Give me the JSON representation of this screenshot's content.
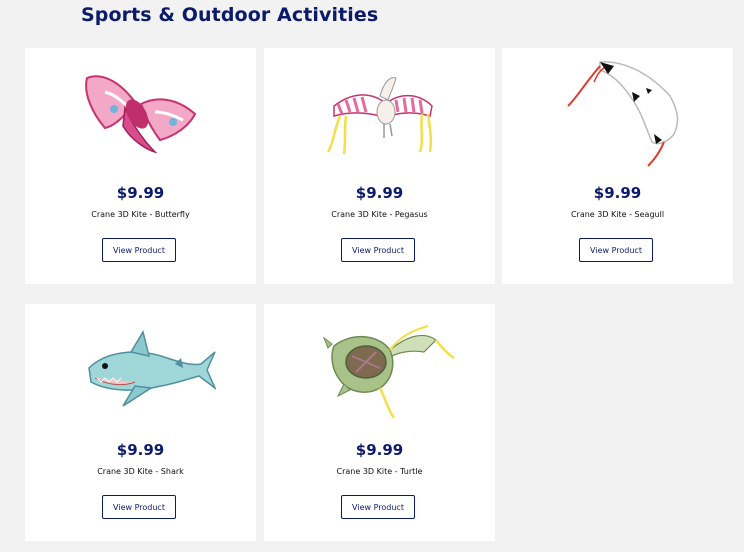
{
  "page": {
    "title": "Sports & Outdoor Activities"
  },
  "products": [
    {
      "price": "$9.99",
      "name": "Crane 3D Kite - Butterfly",
      "button": "View Product"
    },
    {
      "price": "$9.99",
      "name": "Crane 3D Kite - Pegasus",
      "button": "View Product"
    },
    {
      "price": "$9.99",
      "name": "Crane 3D Kite - Seagull",
      "button": "View Product"
    },
    {
      "price": "$9.99",
      "name": "Crane 3D Kite - Shark",
      "button": "View Product"
    },
    {
      "price": "$9.99",
      "name": "Crane 3D Kite - Turtle",
      "button": "View Product"
    }
  ],
  "colors": {
    "brand_navy": "#0b1a6b",
    "background": "#f2f2f2",
    "card": "#ffffff"
  }
}
